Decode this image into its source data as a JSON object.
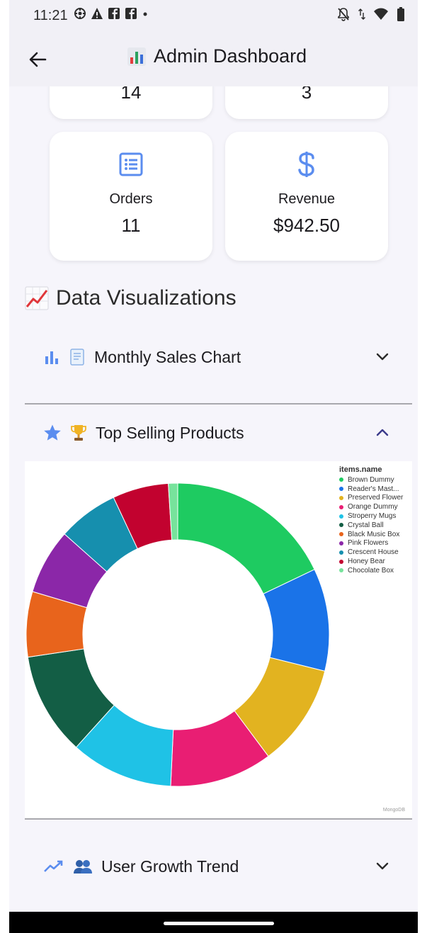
{
  "status_bar": {
    "time": "11:21",
    "left_icons": [
      "settings-icon",
      "warning-icon",
      "facebook-icon",
      "facebook-icon",
      "dot-icon"
    ],
    "right_icons": [
      "mute-icon",
      "data-arrows-icon",
      "wifi-icon",
      "battery-icon"
    ]
  },
  "appbar": {
    "title": "Admin Dashboard",
    "title_icon": "bar-chart-emoji-icon",
    "back_icon": "back-arrow-icon"
  },
  "stats": {
    "top_left_value": "14",
    "top_right_value": "3",
    "orders": {
      "label": "Orders",
      "value": "11",
      "icon": "list-icon"
    },
    "revenue": {
      "label": "Revenue",
      "value": "$942.50",
      "icon": "dollar-icon"
    }
  },
  "section": {
    "title": "Data Visualizations",
    "icon": "trending-chart-emoji-icon"
  },
  "panels": [
    {
      "label": "Monthly Sales Chart",
      "expanded": false,
      "icons": [
        "bar-chart-icon",
        "receipt-icon"
      ]
    },
    {
      "label": "Top Selling Products",
      "expanded": true,
      "icons": [
        "star-icon",
        "trophy-icon"
      ]
    },
    {
      "label": "User Growth Trend",
      "expanded": false,
      "icons": [
        "trend-up-icon",
        "people-icon"
      ]
    }
  ],
  "colors": {
    "accent": "#5b8def",
    "chevron": "#2b2b2b",
    "chevron_open": "#3b3a8a"
  },
  "chart_data": {
    "type": "pie",
    "legend_title": "items.name",
    "legend_position": "top-right",
    "donut": true,
    "categories": [
      "Brown Dummy",
      "Reader's Mast...",
      "Preserved Flower",
      "Orange Dummy",
      "Stroperry Mugs",
      "Crystal Ball",
      "Black Music Box",
      "Pink Flowers",
      "Crescent House",
      "Honey Bear",
      "Chocolate Box"
    ],
    "values": [
      18,
      11,
      11,
      11,
      11,
      11,
      7,
      7,
      6.5,
      6,
      1
    ],
    "colors": [
      "#1ecb61",
      "#1a73e8",
      "#e2b320",
      "#e91e73",
      "#1fc2e6",
      "#135e45",
      "#e8641c",
      "#8b27a8",
      "#168fae",
      "#c2022f",
      "#77e39c"
    ],
    "watermark": "MongoDB"
  }
}
